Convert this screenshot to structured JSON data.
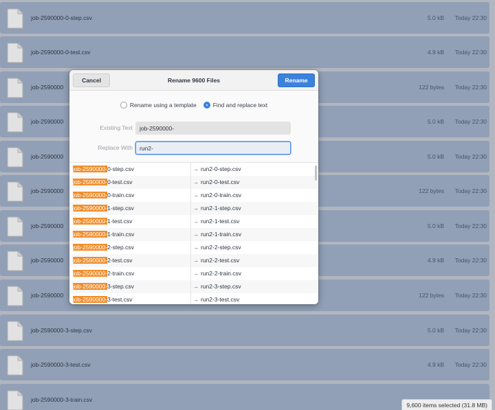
{
  "files": [
    {
      "name": "job-2590000-0-step.csv",
      "size": "5.0 kB",
      "date": "Today 22:30"
    },
    {
      "name": "job-2590000-0-test.csv",
      "size": "4.9 kB",
      "date": "Today 22:30"
    },
    {
      "name": "job-2590000",
      "size": "122 bytes",
      "date": "Today 22:30"
    },
    {
      "name": "job-2590000",
      "size": "5.0 kB",
      "date": "Today 22:30"
    },
    {
      "name": "job-2590000",
      "size": "5.0 kB",
      "date": "Today 22:30"
    },
    {
      "name": "job-2590000",
      "size": "122 bytes",
      "date": "Today 22:30"
    },
    {
      "name": "job-2590000",
      "size": "5.0 kB",
      "date": "Today 22:30"
    },
    {
      "name": "job-2590000",
      "size": "4.9 kB",
      "date": "Today 22:30"
    },
    {
      "name": "job-2590000",
      "size": "122 bytes",
      "date": "Today 22:30"
    },
    {
      "name": "job-2590000-3-step.csv",
      "size": "5.0 kB",
      "date": "Today 22:30"
    },
    {
      "name": "job-2590000-3-test.csv",
      "size": "4.9 kB",
      "date": "Today 22:30"
    },
    {
      "name": "job-2590000-3-train.csv",
      "size": "",
      "date": ""
    }
  ],
  "status": "9,600 items selected (31.8 MB)",
  "dialog": {
    "title": "Rename 9600 Files",
    "cancel_label": "Cancel",
    "rename_label": "Rename",
    "mode_template_label": "Rename using a template",
    "mode_replace_label": "Find and replace text",
    "selected_mode": "replace",
    "existing_label": "Existing Text",
    "existing_value": "job-2590000-",
    "replace_label": "Replace With",
    "replace_value": "run2-",
    "arrow": "→",
    "preview": [
      {
        "match": "job-2590000-",
        "rest": "0-step.csv",
        "new": "run2-0-step.csv"
      },
      {
        "match": "job-2590000-",
        "rest": "0-test.csv",
        "new": "run2-0-test.csv"
      },
      {
        "match": "job-2590000-",
        "rest": "0-train.csv",
        "new": "run2-0-train.csv"
      },
      {
        "match": "job-2590000-",
        "rest": "1-step.csv",
        "new": "run2-1-step.csv"
      },
      {
        "match": "job-2590000-",
        "rest": "1-test.csv",
        "new": "run2-1-test.csv"
      },
      {
        "match": "job-2590000-",
        "rest": "1-train.csv",
        "new": "run2-1-train.csv"
      },
      {
        "match": "job-2590000-",
        "rest": "2-step.csv",
        "new": "run2-2-step.csv"
      },
      {
        "match": "job-2590000-",
        "rest": "2-test.csv",
        "new": "run2-2-test.csv"
      },
      {
        "match": "job-2590000-",
        "rest": "2-train.csv",
        "new": "run2-2-train.csv"
      },
      {
        "match": "job-2590000-",
        "rest": "3-step.csv",
        "new": "run2-3-step.csv"
      },
      {
        "match": "job-2590000-",
        "rest": "3-test.csv",
        "new": "run2-3-test.csv"
      }
    ]
  },
  "colors": {
    "accent": "#3b82dd",
    "match_highlight": "#f28c28",
    "selected_row": "#96a6be"
  },
  "icons": {
    "file": "file-icon",
    "arrow": "arrow-right-icon"
  }
}
